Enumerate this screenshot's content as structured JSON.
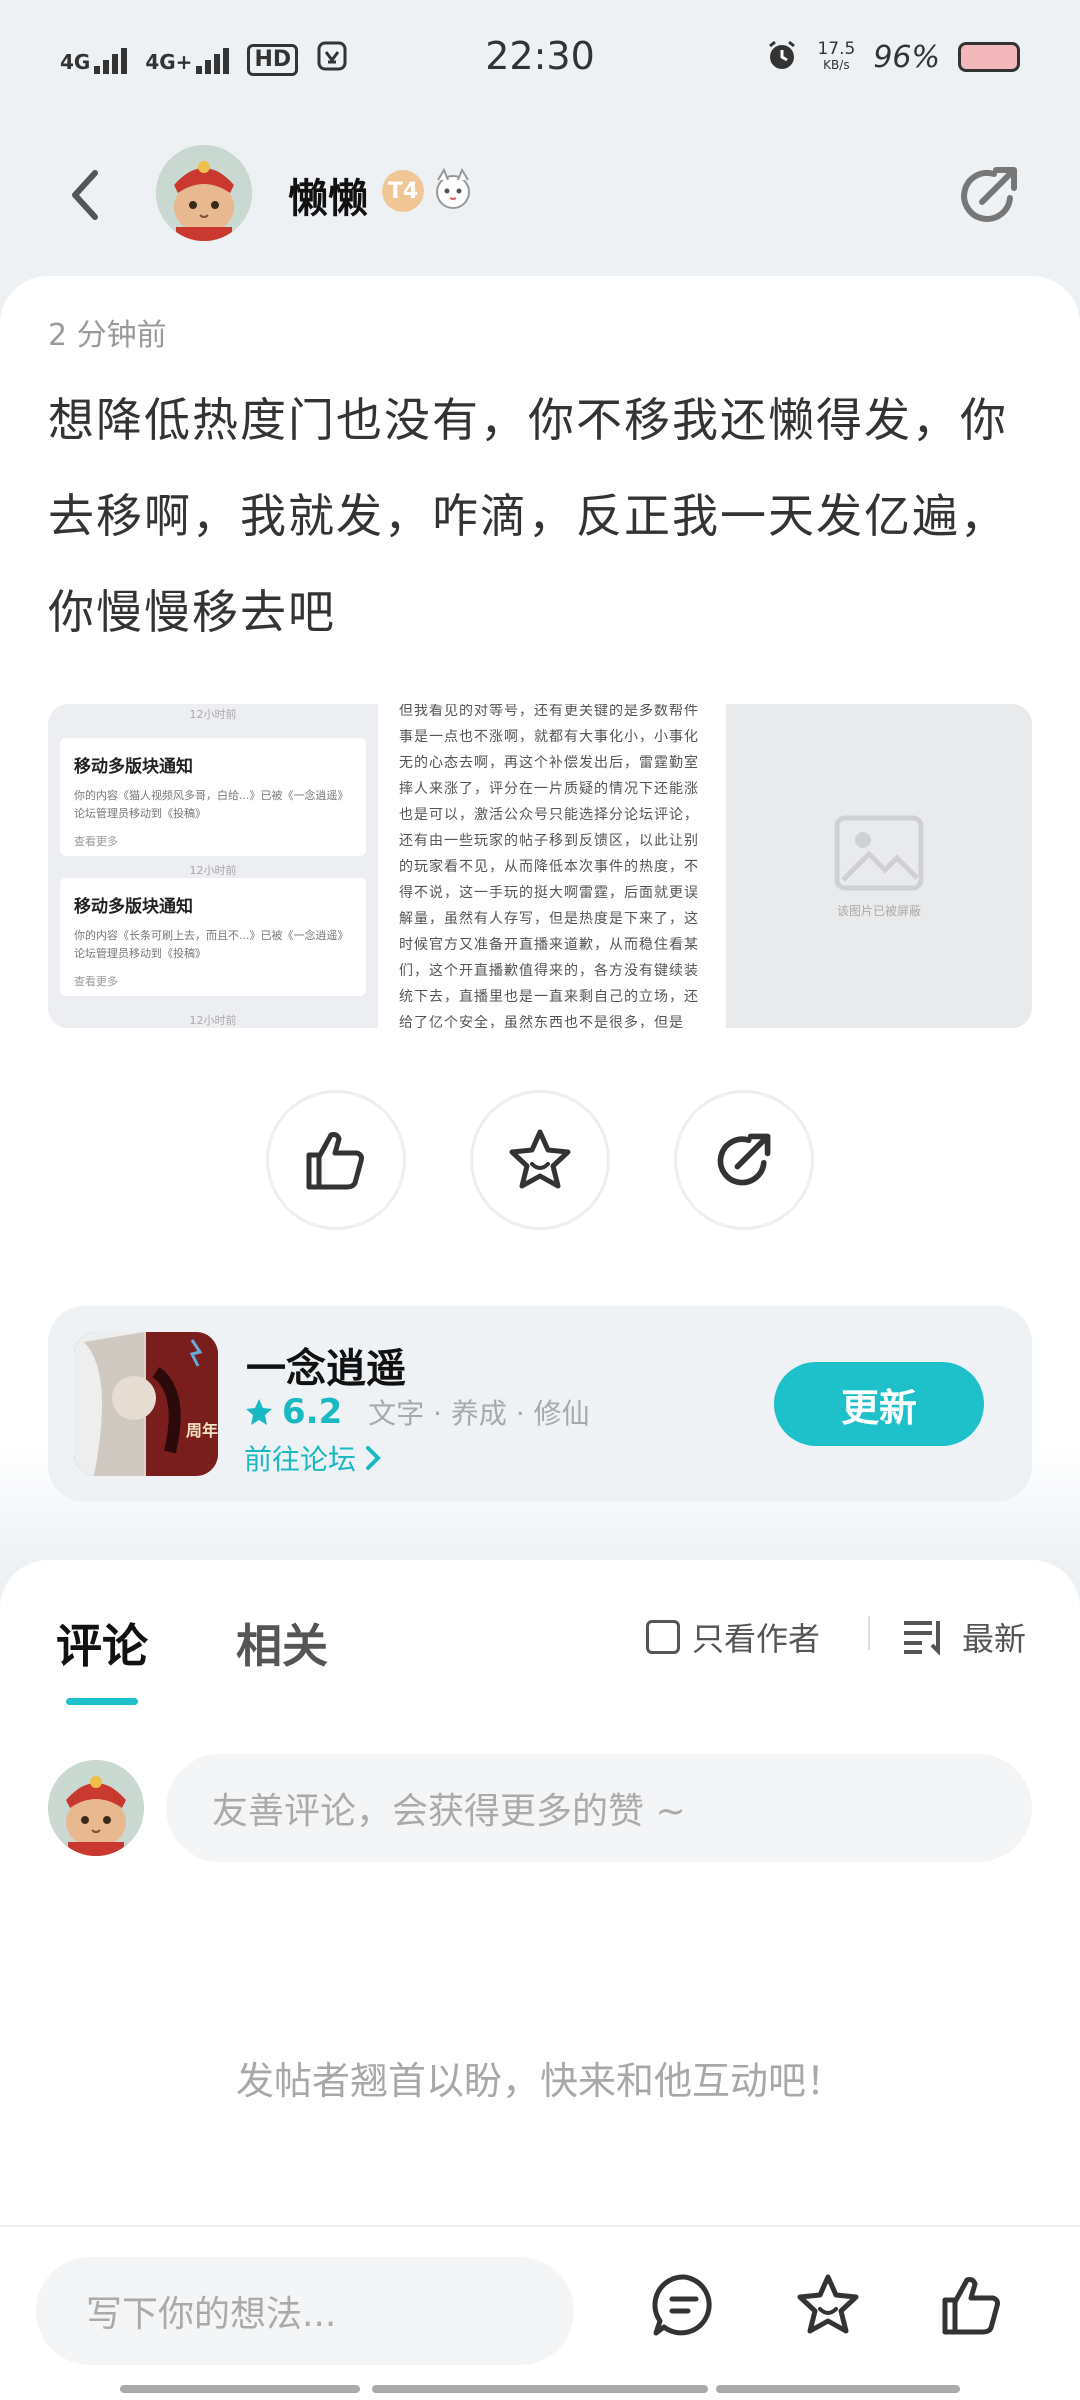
{
  "status_bar": {
    "network1": "4G",
    "network2": "4G+",
    "hd": "HD",
    "time": "22:30",
    "speed": "17.5",
    "speed_unit": "KB/s",
    "battery": "96%"
  },
  "header": {
    "username": "懒懒",
    "level_badge": "T4"
  },
  "post": {
    "time": "2 分钟前",
    "text": "想降低热度门也没有，你不移我还懒得发，你去移啊，我就发，咋滴，反正我一天发亿遍，你慢慢移去吧",
    "image1": {
      "time_top": "12小时前",
      "time_mid": "12小时前",
      "time_bottom": "12小时前",
      "notice1_title": "移动多版块通知",
      "notice1_body": "你的内容《猫人视频风多哥，白给...》已被《一念逍遥》论坛管理员移动到《投稿》",
      "notice1_link": "查看更多",
      "notice2_title": "移动多版块通知",
      "notice2_body": "你的内容《长条可刷上去，而且不...》已被《一念逍遥》论坛管理员移动到《投稿》",
      "notice2_link": "查看更多"
    },
    "image2_text": "但我看见的对等号，还有更关键的是多数帮件事是一点也不涨啊，就都有大事化小，小事化无的心态去啊，再这个补偿发出后，雷霆勤室摔人来涨了，评分在一片质疑的情况下还能涨也是可以，激活公众号只能选择分论坛评论，还有由一些玩家的帖子移到反馈区，以此让别的玩家看不见，从而降低本次事件的热度，不得不说，这一手玩的挺大啊雷霆，后面就更误解量，虽然有人存写，但是热度是下来了，这时候官方又准备开直播来道歉，从而稳住看某们，这个开直播歉值得来的，各方没有键续装统下去，直播里也是一直来剩自己的立场，还给了亿个安全，虽然东西也不是很多，但是",
    "image3_caption": "该图片已被屏蔽"
  },
  "actions": {
    "like": "thumbs-up-icon",
    "favorite": "star-icon",
    "share": "share-icon"
  },
  "app": {
    "name": "一念逍遥",
    "score": "6.2",
    "tags": "文字 · 养成 · 修仙",
    "forum_link": "前往论坛",
    "update_button": "更新",
    "icon_label": "周年庆"
  },
  "comments": {
    "tab_comments": "评论",
    "tab_related": "相关",
    "author_only": "只看作者",
    "sort": "最新",
    "input_placeholder": "友善评论，会获得更多的赞 ~",
    "empty_hint": "发帖者翘首以盼，快来和他互动吧！"
  },
  "bottom_bar": {
    "input_placeholder": "写下你的想法..."
  },
  "colors": {
    "accent": "#1ec0c9",
    "background": "#eef1f4"
  }
}
